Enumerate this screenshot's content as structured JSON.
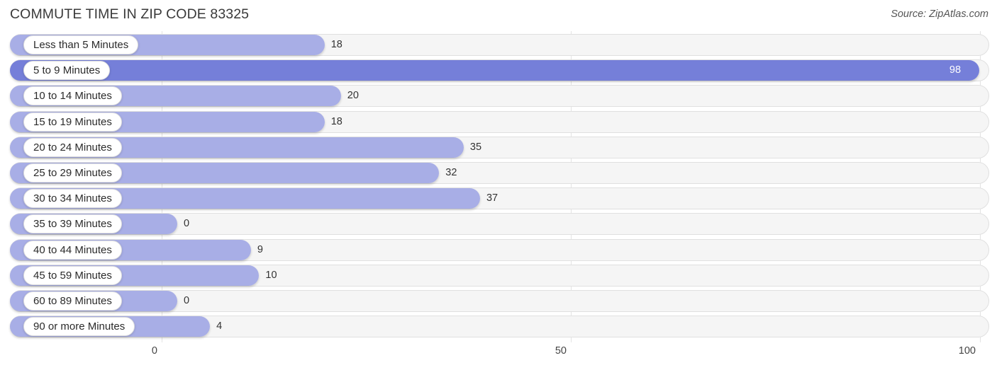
{
  "header": {
    "title": "COMMUTE TIME IN ZIP CODE 83325",
    "source": "Source: ZipAtlas.com"
  },
  "colors": {
    "bar": "#a8aee6",
    "bar_highlight": "#757fd9",
    "track": "#f5f5f5",
    "gridline": "#e3e3e3",
    "text": "#333333"
  },
  "chart_data": {
    "type": "bar",
    "orientation": "horizontal",
    "title": "COMMUTE TIME IN ZIP CODE 83325",
    "xlabel": "",
    "ylabel": "",
    "xlim": [
      0,
      100
    ],
    "grid": true,
    "legend": null,
    "tick_labels": [
      "0",
      "50",
      "100"
    ],
    "tick_values": [
      0,
      50,
      100
    ],
    "categories": [
      "Less than 5 Minutes",
      "5 to 9 Minutes",
      "10 to 14 Minutes",
      "15 to 19 Minutes",
      "20 to 24 Minutes",
      "25 to 29 Minutes",
      "30 to 34 Minutes",
      "35 to 39 Minutes",
      "40 to 44 Minutes",
      "45 to 59 Minutes",
      "60 to 89 Minutes",
      "90 or more Minutes"
    ],
    "values": [
      18,
      98,
      20,
      18,
      35,
      32,
      37,
      0,
      9,
      10,
      0,
      4
    ],
    "value_labels": [
      "18",
      "98",
      "20",
      "18",
      "35",
      "32",
      "37",
      "0",
      "9",
      "10",
      "0",
      "4"
    ],
    "highlight_index": 1
  }
}
